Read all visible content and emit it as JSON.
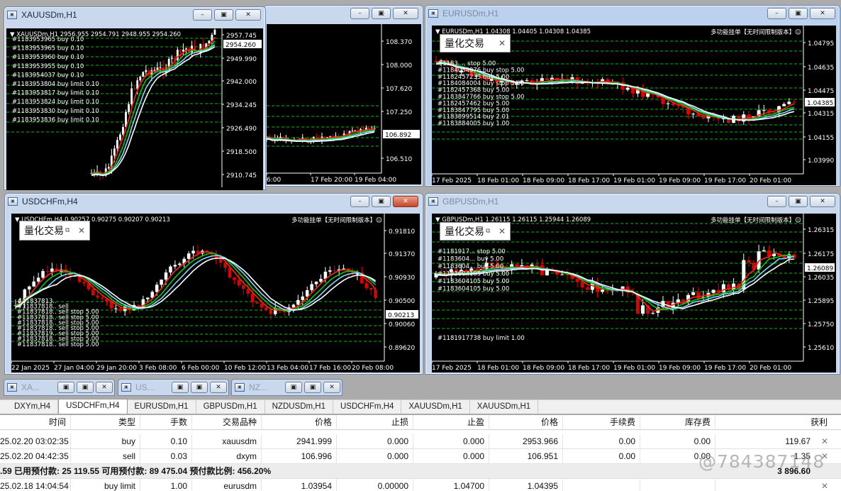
{
  "windows": {
    "back": {
      "buttons": [
        "–",
        "▣",
        "✕"
      ],
      "xlabels": [
        "6:00",
        "17 Feb 20:00",
        "19 Feb 04:00"
      ],
      "ylabels": [
        "108.370",
        "108.000",
        "107.620",
        "107.250",
        "106.892",
        "106.510"
      ],
      "price_tag": "106.892"
    },
    "xauusd": {
      "title": "XAUUSDm,H1",
      "header": "XAUUSDm,H1 2956.955 2954.791 2948.955 2954.260",
      "ylabels": [
        "2957.745",
        "2954.260",
        "2949.990",
        "2942.000",
        "2934.245",
        "2926.490",
        "2918.500",
        "2910.745"
      ],
      "price_tag": "2954.260",
      "orders": [
        "#1183953965 buy 0.10",
        "#1183953965 buy 0.10",
        "#1183953960 buy 0.10",
        "#1183953955 buy 0.10",
        "#1183954037 buy 0.10",
        "#1183953804 buy limit 0.10",
        "#1183953817 buy limit 0.10",
        "#1183953824 buy limit 0.10",
        "#1183953830 buy limit 0.10",
        "#1183953836 buy limit 0.10"
      ],
      "buttons": [
        "–",
        "▣",
        "✕"
      ]
    },
    "eurusd": {
      "title": "EURUSDm,H1",
      "header": "EURUSDm,H1 1.04308 1.04405 1.04308 1.04385",
      "ea": "多功能挂单【无时间限制版本】☺",
      "ylabels": [
        "1.04795",
        "1.04635",
        "1.04475",
        "1.04385",
        "1.04315",
        "1.04155",
        "1.03990"
      ],
      "price_tag": "1.04385",
      "xlabels": [
        "17 Feb 2025",
        "18 Feb 01:00",
        "18 Feb 09:00",
        "18 Feb 17:00",
        "19 Feb 01:00",
        "19 Feb 09:00",
        "19 Feb 17:00",
        "20 Feb 01:00"
      ],
      "orders": [
        "#1183..., stop 5.00",
        "#1184084076 buy stop 5.00",
        "#1182457233 buy 5.00",
        "#1184084004 buy stop 5.00",
        "#1182457368 buy 5.00",
        "#1183847766 buy stop 5.00",
        "#1182457462 buy 5.00",
        "#1183847795 buy 5.00",
        "#1183899514 buy 2.01",
        "#1183884005 buy 1.00"
      ],
      "panel": "量化交易",
      "buttons": [
        "–",
        "▣",
        "✕"
      ]
    },
    "usdchf": {
      "title": "USDCHFm,H4",
      "header": "USDCHFm,H4 0.90257 0.90275 0.90207 0.90213",
      "ea": "多功能挂单【无时间限制版本】☺",
      "ylabels": [
        "0.91810",
        "0.91370",
        "0.90930",
        "0.90500",
        "0.90213",
        "0.90060",
        "0.89620"
      ],
      "price_tag": "0.90213",
      "xlabels": [
        "22 Jan 2025",
        "27 Jan 04:00",
        "29 Jan 20:00",
        "3 Feb 08:00",
        "6 Feb 00:00",
        "10 Feb 12:00",
        "13 Feb 04:00",
        "17 Feb 16:00",
        "20 Feb 08:00"
      ],
      "orders": [
        "#11837813..",
        "#11837818.. sell",
        "#11837818.. sell stop 5.00",
        "#11837818.. sell stop 5.00",
        "#11837818.. sell stop 5.00",
        "#11837818.. sell stop 5.00",
        "#11837819.. sell stop 5.00",
        "#11837818.. sell stop 5.00",
        "#11837818.. sell stop 5.00"
      ],
      "panel": "量化交易",
      "buttons": [
        "–",
        "▣",
        "✕"
      ]
    },
    "gbpusd": {
      "title": "GBPUSDm,H1",
      "header": "GBPUSDm,H1 1.26115 1.26115 1.25944 1.26089",
      "ea": "多功能挂单【无时间限制版本】☺",
      "ylabels": [
        "1.26315",
        "1.26175",
        "1.26089",
        "1.26035",
        "1.25895",
        "1.25750",
        "1.25610"
      ],
      "price_tag": "1.26089",
      "xlabels": [
        "17 Feb 2025",
        "18 Feb 01:00",
        "18 Feb 09:00",
        "18 Feb 17:00",
        "19 Feb 01:00",
        "19 Feb 09:00",
        "19 Feb 17:00",
        "20 Feb 01:00"
      ],
      "orders": [
        "#1181917... stop 5.00",
        "#1183604... buy 5.00",
        "#1183604... buy 5.00",
        "#1183604105 buy 5.00",
        "#1183604105 buy 5.00",
        "#1183604105 buy 5.00",
        "#1181917738 buy limit 1.00"
      ],
      "panel": "量化交易",
      "buttons": [
        "–",
        "▣",
        "✕"
      ]
    }
  },
  "minimized": [
    {
      "title": "XA...",
      "buttons": [
        "▣",
        "▣",
        "✕"
      ]
    },
    {
      "title": "US...",
      "buttons": [
        "▣",
        "▣",
        "✕"
      ]
    },
    {
      "title": "NZ...",
      "buttons": [
        "▣",
        "▣",
        "✕"
      ]
    }
  ],
  "tabs": [
    "DXYm,H4",
    "USDCHFm,H4",
    "EURUSDm,H1",
    "GBPUSDm,H1",
    "NZDUSDm,H1",
    "USDCHFm,H4",
    "XAUUSDm,H1",
    "XAUUSDm,H1"
  ],
  "selected_tab": 1,
  "table": {
    "headers": [
      "时间",
      "类型",
      "手数",
      "交易品种",
      "价格",
      "止损",
      "止盈",
      "价格",
      "手续费",
      "库存费",
      "获利"
    ],
    "rows": [
      [
        "25.02.20 03:02:35",
        "buy",
        "0.10",
        "xauusdm",
        "2941.999",
        "0.000",
        "0.000",
        "2953.966",
        "0.00",
        "0.00",
        "119.67"
      ],
      [
        "25.02.20 04:42:35",
        "sell",
        "0.03",
        "dxym",
        "106.996",
        "0.000",
        "0.000",
        "106.951",
        "0.00",
        "0.00",
        "1.35"
      ]
    ],
    "summary": ".59  已用预付款: 25 119.55  可用预付款: 89 475.04  预付款比例: 456.20%",
    "summary_total": "3 896.60",
    "pending": [
      "25.02.18 14:04:54",
      "buy limit",
      "1.00",
      "eurusdm",
      "1.03954",
      "0.00000",
      "1.04700",
      "1.04395",
      "",
      "",
      ""
    ],
    "close_glyph": "✕"
  },
  "watermark": "@784387148",
  "colors": {
    "bull": "#ffffff",
    "bear": "#e00000",
    "ma_red": "#ff2020",
    "ma_green": "#00c800",
    "ma_white": "#ffffff",
    "ma_cyan": "#7fd8ff",
    "grid_green": "#00c000",
    "price_tag": "#ffffff"
  }
}
